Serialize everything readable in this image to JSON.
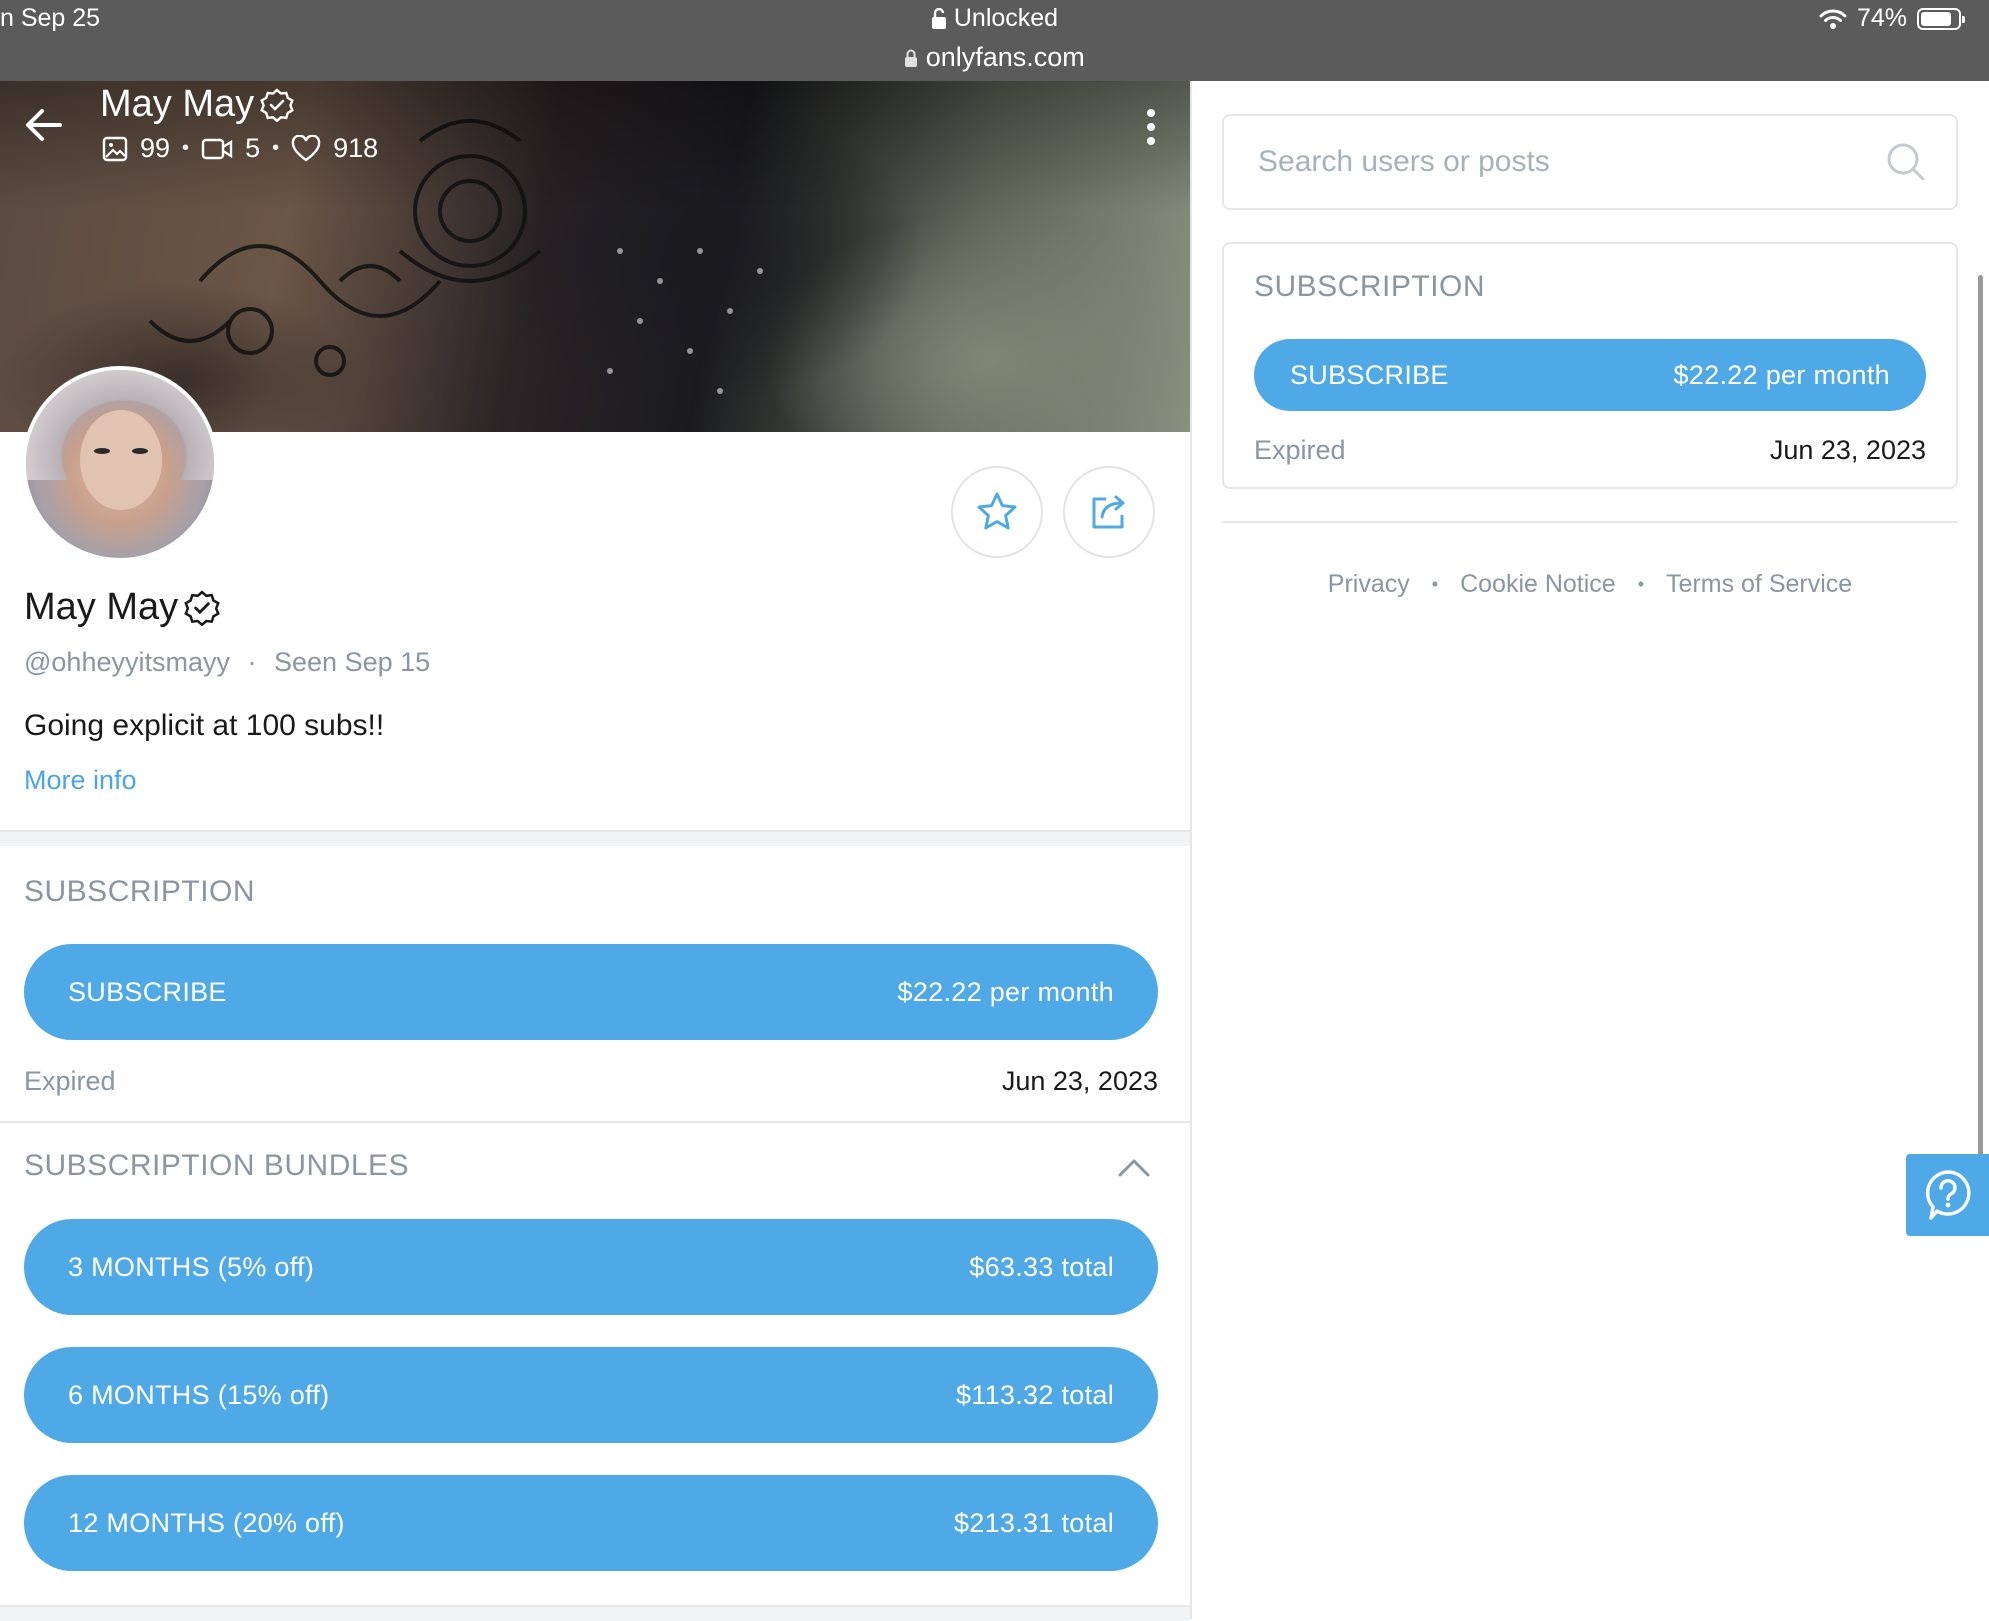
{
  "status_bar": {
    "time_partial": "n Sep 25",
    "lock_status": "Unlocked",
    "url": "onlyfans.com",
    "battery": "74%"
  },
  "header": {
    "name": "May May",
    "stats": {
      "photos": "99",
      "videos": "5",
      "likes": "918"
    }
  },
  "profile": {
    "name": "May May",
    "handle": "@ohheyyitsmayy",
    "seen_label": "Seen",
    "seen_date": "Sep 15",
    "bio": "Going explicit at 100 subs!!",
    "more_info": "More info"
  },
  "subscription": {
    "title": "SUBSCRIPTION",
    "button_label": "SUBSCRIBE",
    "price": "$22.22 per month",
    "status_label": "Expired",
    "status_date": "Jun 23, 2023"
  },
  "bundles": {
    "title": "SUBSCRIPTION BUNDLES",
    "items": [
      {
        "label": "3 MONTHS (5% off)",
        "price": "$63.33 total"
      },
      {
        "label": "6 MONTHS (15% off)",
        "price": "$113.32 total"
      },
      {
        "label": "12 MONTHS (20% off)",
        "price": "$213.31 total"
      }
    ]
  },
  "sidebar": {
    "search_placeholder": "Search users or posts",
    "subscription": {
      "title": "SUBSCRIPTION",
      "button_label": "SUBSCRIBE",
      "price": "$22.22 per month",
      "status_label": "Expired",
      "status_date": "Jun 23, 2023"
    },
    "footer": [
      "Privacy",
      "Cookie Notice",
      "Terms of Service"
    ]
  },
  "colors": {
    "accent": "#4fa9e6",
    "muted": "#8a96a3",
    "status_bar": "#5b5b5b"
  }
}
